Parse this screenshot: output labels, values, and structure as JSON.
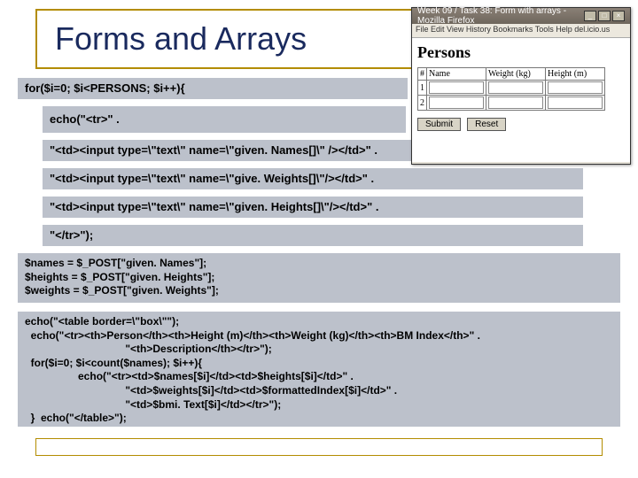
{
  "title": "Forms and Arrays",
  "code": {
    "for_line": "for($i=0; $i<PERSONS; $i++){",
    "echo_tr": "echo(\"<tr>\" .",
    "echo_names": "\"<td><input type=\\\"text\\\" name=\\\"given. Names[]\\\" /></td>\" .",
    "echo_weights": "\"<td><input type=\\\"text\\\" name=\\\"give. Weights[]\\\"/></td>\" .",
    "echo_heights": "\"<td><input type=\\\"text\\\" name=\\\"given. Heights[]\\\"/></td>\" .",
    "echo_close": "\"</tr>\");",
    "block1": "$names = $_POST[\"given. Names\"];\n$heights = $_POST[\"given. Heights\"];\n$weights = $_POST[\"given. Weights\"];",
    "block2": "echo(\"<table border=\\\"box\\\"\");\n  echo(\"<tr><th>Person</th><th>Height (m)</th><th>Weight (kg)</th><th>BM Index</th>\" .\n                                  \"<th>Description</th></tr>\");\n  for($i=0; $i<count($names); $i++){\n                  echo(\"<tr><td>$names[$i]</td><td>$heights[$i]</td>\" .\n                                  \"<td>$weights[$i]</td><td>$formattedIndex[$i]</td>\" .\n                                  \"<td>$bmi. Text[$i]</td></tr>\");\n  }  echo(\"</table>\");"
  },
  "browser": {
    "titlebar": "Week 09 / Task 38: Form with arrays - Mozilla Firefox",
    "menu": "File  Edit  View  History  Bookmarks  Tools  Help  del.icio.us",
    "heading": "Persons",
    "headers": {
      "h0": "#",
      "h1": "Name",
      "h2": "Weight (kg)",
      "h3": "Height (m)"
    },
    "rows": {
      "r1": "1",
      "r2": "2"
    },
    "buttons": {
      "submit": "Submit",
      "reset": "Reset"
    }
  },
  "winbtns": {
    "min": "_",
    "max": "□",
    "close": "×"
  }
}
